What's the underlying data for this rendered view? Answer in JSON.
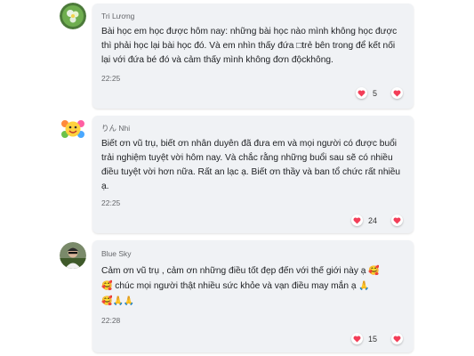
{
  "comments": [
    {
      "author": "Tri Lương",
      "text": "Bài học em học được hôm nay:  những bài học nào mình không học được thì phải học lại bài học đó. Và em nhìn thấy đứa □trẻ bên trong để kết nối lại với đứa bé đó và cảm thấy mình không đơn độckhông.",
      "time": "22:25",
      "count": "5"
    },
    {
      "author": "りん Nhi",
      "text": "Biết ơn vũ trụ, biết ơn nhân duyên đã đưa em và mọi người có được buổi trải nghiệm tuyệt vời hôm nay. Và chắc rằng những buổi sau sẽ có nhiều điều tuyệt vời hơn nữa. Rất an lạc ạ. Biết ơn thầy và ban tổ chức rất nhiều ạ.",
      "time": "22:25",
      "count": "24"
    },
    {
      "author": "Blue Sky",
      "text_line1": "Cảm ơn vũ trụ , cảm ơn những điều tốt đẹp đến với thế giới này ạ",
      "text_line2": "chúc mọi người thật nhiều sức khỏe và vạn điều may mắn ạ",
      "emoji_face": "🥰",
      "emoji_pray": "🙏",
      "time": "22:28",
      "count": "15"
    }
  ],
  "colors": {
    "card_bg": "#f0f2f5",
    "heart_red": "#f33e58",
    "meta_gray": "#65676b"
  },
  "icons": {
    "reaction": "heart-icon",
    "avatar1": "green-flower-avatar",
    "avatar2": "smiley-sun-avatar",
    "avatar3": "photo-avatar"
  }
}
